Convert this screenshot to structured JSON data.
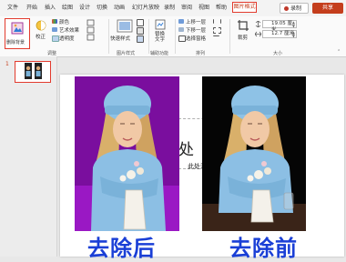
{
  "menu": {
    "items": [
      "文件",
      "开始",
      "插入",
      "绘图",
      "设计",
      "切换",
      "动画",
      "幻灯片放映",
      "录制",
      "审阅",
      "视图",
      "帮助"
    ],
    "active_tab": "图片格式",
    "record_label": "录制",
    "share_label": "共享"
  },
  "ribbon": {
    "remove_bg": "删除背景",
    "correct": "校正",
    "color": "颜色",
    "artistic": "艺术效果",
    "transparency": "透明度",
    "group_adjust": "调整",
    "quick_styles": "快速样式",
    "group_styles": "图片样式",
    "alt_text": "替换\n文字",
    "group_access": "辅助功能",
    "bring_forward": "上移一层",
    "send_backward": "下移一层",
    "selection_pane": "选择窗格",
    "group_arrange": "排列",
    "crop": "裁剪",
    "height": "19.05 厘米",
    "width": "12.7 厘米",
    "group_size": "大小"
  },
  "slides": {
    "number": "1"
  },
  "slide": {
    "title": "处",
    "subtitle": "此处添"
  },
  "captions": {
    "after": "去除后",
    "before": "去除前"
  },
  "colors": {
    "accent": "#c43e1c",
    "caption": "#1a3fd6",
    "removed_bg": "#7a0e9e"
  }
}
